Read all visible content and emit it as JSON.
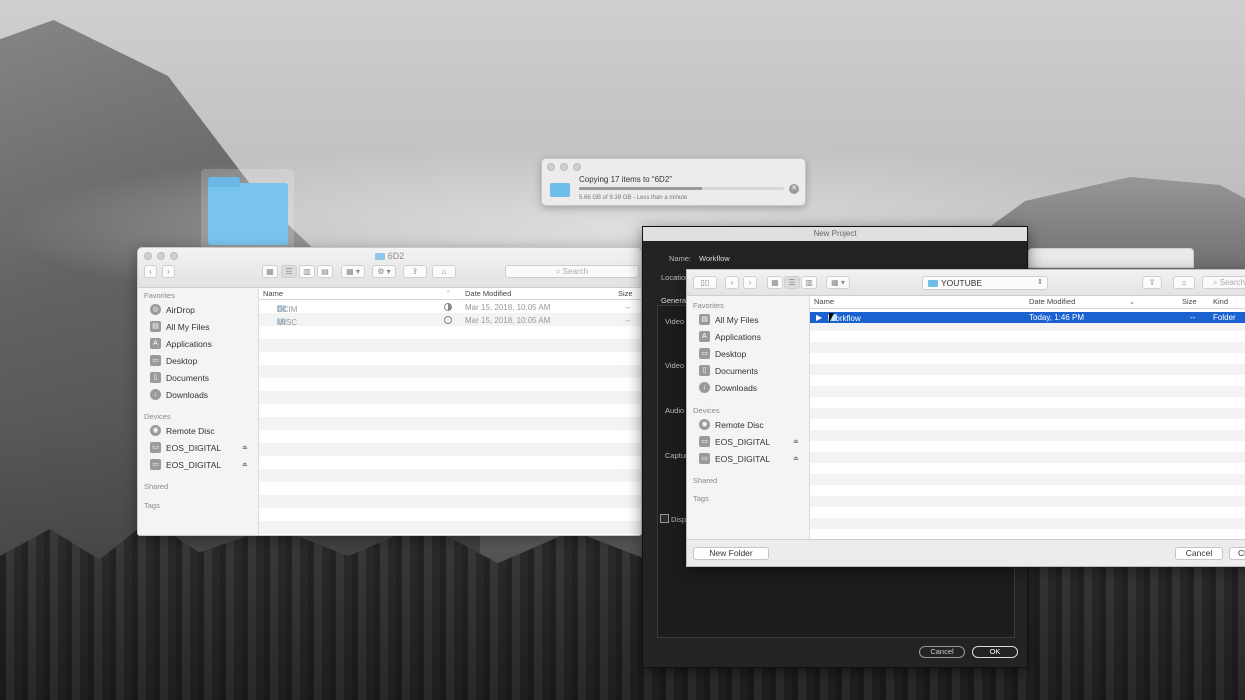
{
  "copy_dialog": {
    "title": "Copying 17 items to “6D2”",
    "status": "5.66 GB of 9.39 GB - Less than a minute",
    "progress": 0.6
  },
  "finder": {
    "title": "6D2",
    "search_placeholder": "Search",
    "sidebar": {
      "favorites_heading": "Favorites",
      "favorites": [
        {
          "label": "AirDrop",
          "icon": "airdrop-icon"
        },
        {
          "label": "All My Files",
          "icon": "all-files-icon"
        },
        {
          "label": "Applications",
          "icon": "applications-icon"
        },
        {
          "label": "Desktop",
          "icon": "desktop-icon"
        },
        {
          "label": "Documents",
          "icon": "documents-icon"
        },
        {
          "label": "Downloads",
          "icon": "downloads-icon"
        }
      ],
      "devices_heading": "Devices",
      "devices": [
        {
          "label": "Remote Disc",
          "icon": "disc-icon"
        },
        {
          "label": "EOS_DIGITAL",
          "icon": "drive-icon"
        },
        {
          "label": "EOS_DIGITAL",
          "icon": "drive-icon"
        }
      ],
      "shared_heading": "Shared",
      "tags_heading": "Tags"
    },
    "columns": {
      "name": "Name",
      "date": "Date Modified",
      "size": "Size"
    },
    "rows": [
      {
        "name": "DCIM",
        "date": "Mar 15, 2018, 10:05 AM",
        "size": "--"
      },
      {
        "name": "MISC",
        "date": "Mar 15, 2018, 10:05 AM",
        "size": "--"
      }
    ]
  },
  "new_project": {
    "title": "New Project",
    "name_label": "Name:",
    "name_value": "Workflow",
    "location_label": "Location",
    "general_tab": "General",
    "video_label_1": "Video",
    "video_label_2": "Video",
    "audio_label": "Audio",
    "capture_label": "Captur",
    "display_label": "Displ",
    "cancel_label": "Cancel",
    "ok_label": "OK"
  },
  "sheet": {
    "path": "YOUTUBE",
    "search_placeholder": "Search",
    "sidebar": {
      "favorites_heading": "Favorites",
      "favorites": [
        {
          "label": "All My Files",
          "icon": "all-files-icon"
        },
        {
          "label": "Applications",
          "icon": "applications-icon"
        },
        {
          "label": "Desktop",
          "icon": "desktop-icon"
        },
        {
          "label": "Documents",
          "icon": "documents-icon"
        },
        {
          "label": "Downloads",
          "icon": "downloads-icon"
        }
      ],
      "devices_heading": "Devices",
      "devices": [
        {
          "label": "Remote Disc",
          "icon": "disc-icon"
        },
        {
          "label": "EOS_DIGITAL",
          "icon": "drive-icon"
        },
        {
          "label": "EOS_DIGITAL",
          "icon": "drive-icon"
        }
      ],
      "shared_heading": "Shared",
      "tags_heading": "Tags"
    },
    "columns": {
      "name": "Name",
      "date": "Date Modified",
      "size": "Size",
      "kind": "Kind"
    },
    "selected_row": {
      "name": "Workflow",
      "date": "Today, 1:46 PM",
      "size": "--",
      "kind": "Folder"
    },
    "new_folder_label": "New Folder",
    "cancel_label": "Cancel",
    "choose_label": "Ch"
  }
}
